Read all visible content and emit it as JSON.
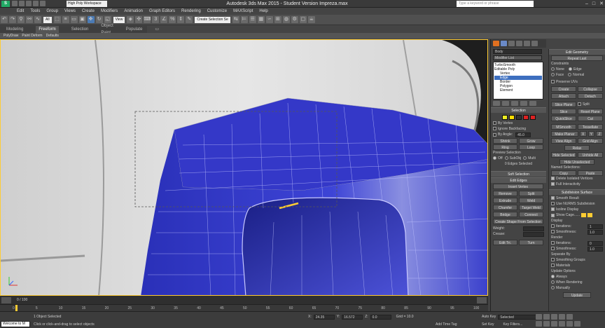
{
  "titlebar": {
    "workspace": "High Poly Workspace",
    "title": "Autodesk 3ds Max  2015   - Student Version   Impreza.max",
    "search_placeholder": "Type a keyword or phrase"
  },
  "menu": [
    "Edit",
    "Tools",
    "Group",
    "Views",
    "Create",
    "Modifiers",
    "Animation",
    "Graph Editors",
    "Rendering",
    "Customize",
    "MAXScript",
    "Help"
  ],
  "toolbar": {
    "selection_filter": "All",
    "ref_coord": "View",
    "named_selection": "Create Selection Se"
  },
  "ribbon": {
    "tabs": [
      "Modeling",
      "Freeform",
      "Selection",
      "Object Paint",
      "Populate"
    ],
    "active_tab": "Freeform",
    "subtabs": [
      "PolyDraw",
      "Paint Deform",
      "Defaults"
    ]
  },
  "command_panel": {
    "object_name": "Body",
    "modifier_list": "Modifier List",
    "stack": [
      "TurboSmooth",
      "Editable Poly",
      "Vertex",
      "Edge",
      "Border",
      "Polygon",
      "Element"
    ],
    "selected_stack": "Edge",
    "selection": {
      "header": "Selection",
      "by_vertex": "By Vertex",
      "ignore_backfacing": "Ignore Backfacing",
      "by_angle": "By Angle:",
      "by_angle_value": "45.0",
      "shrink": "Shrink",
      "grow": "Grow",
      "ring": "Ring",
      "loop": "Loop",
      "preview_selection": "Preview Selection",
      "preview_options": [
        "Off",
        "SubObj",
        "Multi"
      ],
      "status": "0 Edges Selected"
    },
    "soft_selection": "Soft Selection",
    "edit_edges": {
      "header": "Edit Edges",
      "insert_vertex": "Insert Vertex",
      "remove": "Remove",
      "split": "Split",
      "extrude": "Extrude",
      "weld": "Weld",
      "chamfer": "Chamfer",
      "target_weld": "Target Weld",
      "bridge": "Bridge",
      "connect": "Connect",
      "create_shape": "Create Shape From Selection",
      "weight": "Weight:",
      "crease": "Crease:",
      "edit_tri": "Edit Tri.",
      "turn": "Turn"
    }
  },
  "edit_panel": {
    "edit_geometry": "Edit Geometry",
    "repeat_last": "Repeat Last",
    "constraints": "Constraints",
    "constraint_options": [
      "None",
      "Edge",
      "Face",
      "Normal"
    ],
    "preserve_uvs": "Preserve UVs",
    "create": "Create",
    "collapse": "Collapse",
    "attach": "Attach",
    "detach": "Detach",
    "slice_plane": "Slice Plane",
    "split": "Split",
    "slice": "Slice",
    "reset_plane": "Reset Plane",
    "quickslice": "QuickSlice",
    "cut": "Cut",
    "msmooth": "MSmooth",
    "tessellate": "Tessellate",
    "make_planar": "Make Planar",
    "xyz": [
      "X",
      "Y",
      "Z"
    ],
    "view_align": "View Align",
    "grid_align": "Grid Align",
    "relax": "Relax",
    "hide_selected": "Hide Selected",
    "unhide_all": "Unhide All",
    "hide_unselected": "Hide Unselected",
    "named_selections": "Named Selections:",
    "copy": "Copy",
    "paste": "Paste",
    "delete_isolated": "Delete Isolated Vertices",
    "full_interactivity": "Full Interactivity",
    "subdivision_surface": "Subdivision Surface",
    "smooth_result": "Smooth Result",
    "use_nurms": "Use NURMS Subdivision",
    "isoline_display": "Isoline Display",
    "show_cage": "Show Cage......",
    "display": "Display",
    "iterations_label": "Iterations:",
    "iterations_value": "1",
    "smoothness_label": "Smoothness:",
    "smoothness_value": "1.0",
    "render": "Render",
    "render_iterations_value": "0",
    "render_smoothness_value": "1.0",
    "separate_by": "Separate By",
    "smoothing_groups": "Smoothing Groups",
    "materials": "Materials",
    "update_options": "Update Options",
    "update_modes": [
      "Always",
      "When Rendering",
      "Manually"
    ],
    "update": "Update"
  },
  "timeline": {
    "frame_label": "0 / 100",
    "ticks": [
      "0",
      "5",
      "10",
      "15",
      "20",
      "25",
      "30",
      "35",
      "40",
      "45",
      "50",
      "55",
      "60",
      "65",
      "70",
      "75",
      "80",
      "85",
      "90",
      "95",
      "100"
    ]
  },
  "status": {
    "welcome": "Welcome to M",
    "objects": "1 Object Selected",
    "prompt": "Click or click-and-drag to select objects",
    "x": "24.35",
    "y": "16.572",
    "z": "0.0",
    "grid": "Grid = 10.0",
    "auto_key": "Auto Key",
    "selected": "Selected",
    "set_key": "Set Key",
    "key_filters": "Key Filters...",
    "add_time_tag": "Add Time Tag"
  },
  "colors": {
    "mesh": "#2f35c7",
    "highlight": "#ffcc33",
    "viewport_bg": "#d8d8d8"
  }
}
